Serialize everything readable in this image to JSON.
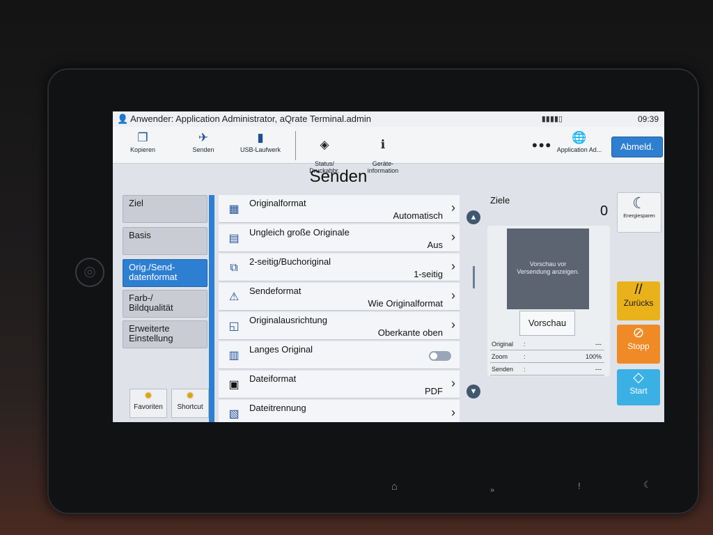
{
  "status_bar": {
    "user": "Anwender: Application Administrator, aQrate Terminal.admin",
    "time": "09:39"
  },
  "toolbar": {
    "items": [
      {
        "label": "Kopieren",
        "icon": "copy-icon"
      },
      {
        "label": "Senden",
        "icon": "send-icon"
      },
      {
        "label": "USB-Laufwerk",
        "icon": "usb-icon"
      },
      {
        "label": "Status/\nDruckabbr.",
        "icon": "status-icon"
      },
      {
        "label": "Geräte-\ninformation",
        "icon": "device-info-icon"
      },
      {
        "label": "Application Ad...",
        "icon": "globe-icon"
      }
    ],
    "logout_label": "Abmeld."
  },
  "page_title": "Senden",
  "tabs": [
    {
      "label": "Ziel",
      "active": false
    },
    {
      "label": "Basis",
      "active": false
    },
    {
      "label": "Orig./Send-\ndatenformat",
      "active": true
    },
    {
      "label": "Farb-/\nBildqualität",
      "active": false
    },
    {
      "label": "Erweiterte\nEinstellung",
      "active": false
    }
  ],
  "shortcuts": [
    {
      "label": "Favoriten"
    },
    {
      "label": "Shortcut"
    }
  ],
  "settings": [
    {
      "label": "Originalformat",
      "value": "Automatisch"
    },
    {
      "label": "Ungleich große Originale",
      "value": "Aus"
    },
    {
      "label": "2-seitig/Buchoriginal",
      "value": "1-seitig"
    },
    {
      "label": "Sendeformat",
      "value": "Wie Originalformat"
    },
    {
      "label": "Originalausrichtung",
      "value": "Oberkante oben"
    },
    {
      "label": "Langes Original",
      "value": ""
    },
    {
      "label": "Dateiformat",
      "value": "PDF"
    },
    {
      "label": "Dateitrennung",
      "value": ""
    }
  ],
  "ziele": {
    "label": "Ziele",
    "count": "0",
    "preview_text": "Vorschau vor\nVersendung anzeigen.",
    "preview_button": "Vorschau",
    "info": [
      {
        "key": "Original",
        "value": "---"
      },
      {
        "key": "Zoom",
        "value": "100%"
      },
      {
        "key": "Senden",
        "value": "---"
      }
    ]
  },
  "side_buttons": {
    "energie": "Energiesparen",
    "zurueck": "Zurücks",
    "stopp": "Stopp",
    "start": "Start"
  },
  "colors": {
    "accent_blue": "#2d7fd2",
    "zurueck_yellow": "#e9b21b",
    "stopp_orange": "#f08a27",
    "start_cyan": "#3bb0e5"
  }
}
